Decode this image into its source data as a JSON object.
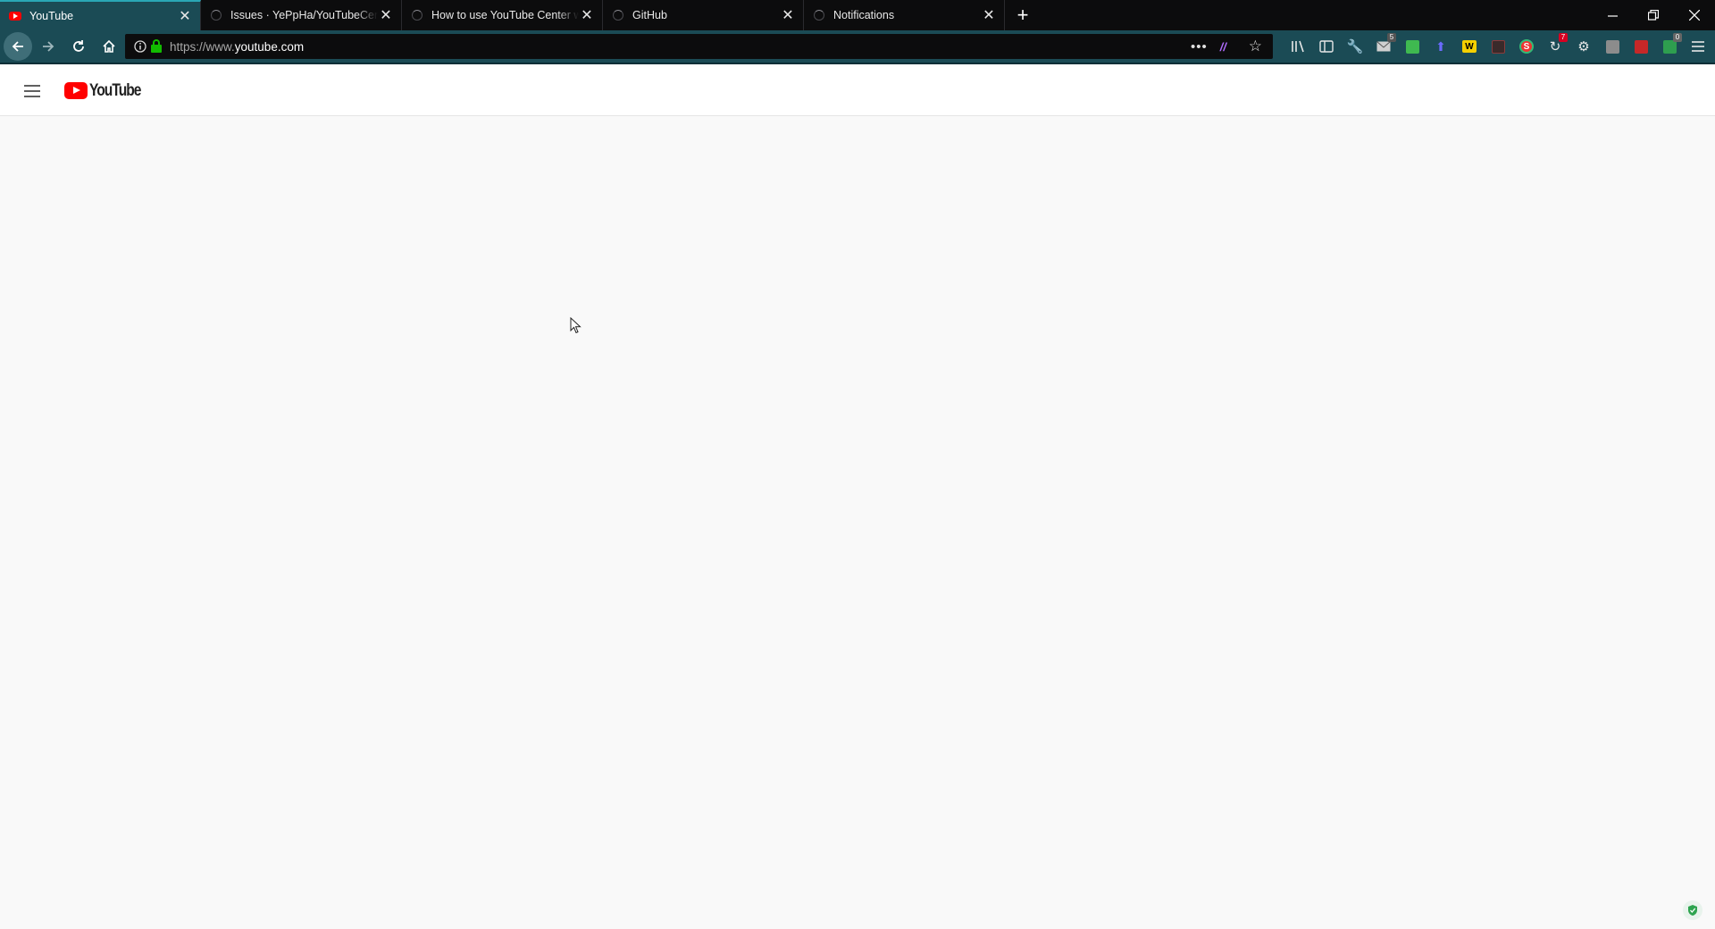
{
  "tabs": [
    {
      "title": "YouTube",
      "active": true,
      "favicon": "youtube-favicon"
    },
    {
      "title": "Issues · YePpHa/YouTubeCenter",
      "active": false,
      "favicon": "loading-spinner"
    },
    {
      "title": "How to use YouTube Center with",
      "active": false,
      "favicon": "loading-spinner"
    },
    {
      "title": "GitHub",
      "active": false,
      "favicon": "loading-spinner"
    },
    {
      "title": "Notifications",
      "active": false,
      "favicon": "loading-spinner"
    }
  ],
  "address_bar": {
    "protocol": "https://www.",
    "host": "youtube.com"
  },
  "toolbar_badges": {
    "mail": "5",
    "notifications": "7",
    "counter": "0"
  },
  "youtube": {
    "logo_text": "YouTube"
  },
  "colors": {
    "tab_active": "#1b4b55",
    "tabstrip": "#0c0c0d",
    "youtube_red": "#ff0000",
    "page_bg": "#f9f9f9"
  }
}
